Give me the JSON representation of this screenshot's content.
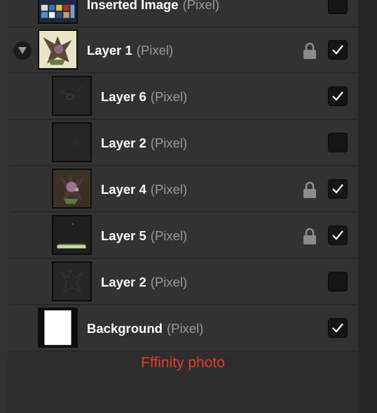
{
  "layers": [
    {
      "name": "Inserted Image",
      "kind": "(Pixel)",
      "visible": false,
      "locked": false,
      "level": 0,
      "expandable": false,
      "thumb": "collage-thumb"
    },
    {
      "name": "Layer 1",
      "kind": "(Pixel)",
      "visible": true,
      "locked": true,
      "level": 0,
      "expandable": true,
      "thumb": "creature-thumb"
    },
    {
      "name": "Layer 6",
      "kind": "(Pixel)",
      "visible": true,
      "locked": false,
      "level": 1,
      "expandable": false,
      "thumb": "sketch-thumb"
    },
    {
      "name": "Layer 2",
      "kind": "(Pixel)",
      "visible": false,
      "locked": false,
      "level": 1,
      "expandable": false,
      "thumb": "dark-thumb"
    },
    {
      "name": "Layer 4",
      "kind": "(Pixel)",
      "visible": true,
      "locked": true,
      "level": 1,
      "expandable": false,
      "thumb": "figure-thumb"
    },
    {
      "name": "Layer 5",
      "kind": "(Pixel)",
      "visible": true,
      "locked": true,
      "level": 1,
      "expandable": false,
      "thumb": "ground-thumb"
    },
    {
      "name": "Layer 2",
      "kind": "(Pixel)",
      "visible": false,
      "locked": false,
      "level": 1,
      "expandable": false,
      "thumb": "sketch2-thumb"
    },
    {
      "name": "Background",
      "kind": "(Pixel)",
      "visible": true,
      "locked": false,
      "level": 0,
      "expandable": false,
      "thumb": "white-thumb"
    }
  ],
  "caption": "Fffinity photo",
  "colors": {
    "caption": "#e0402a",
    "panel": "#323232",
    "checkbox": "#151515"
  }
}
